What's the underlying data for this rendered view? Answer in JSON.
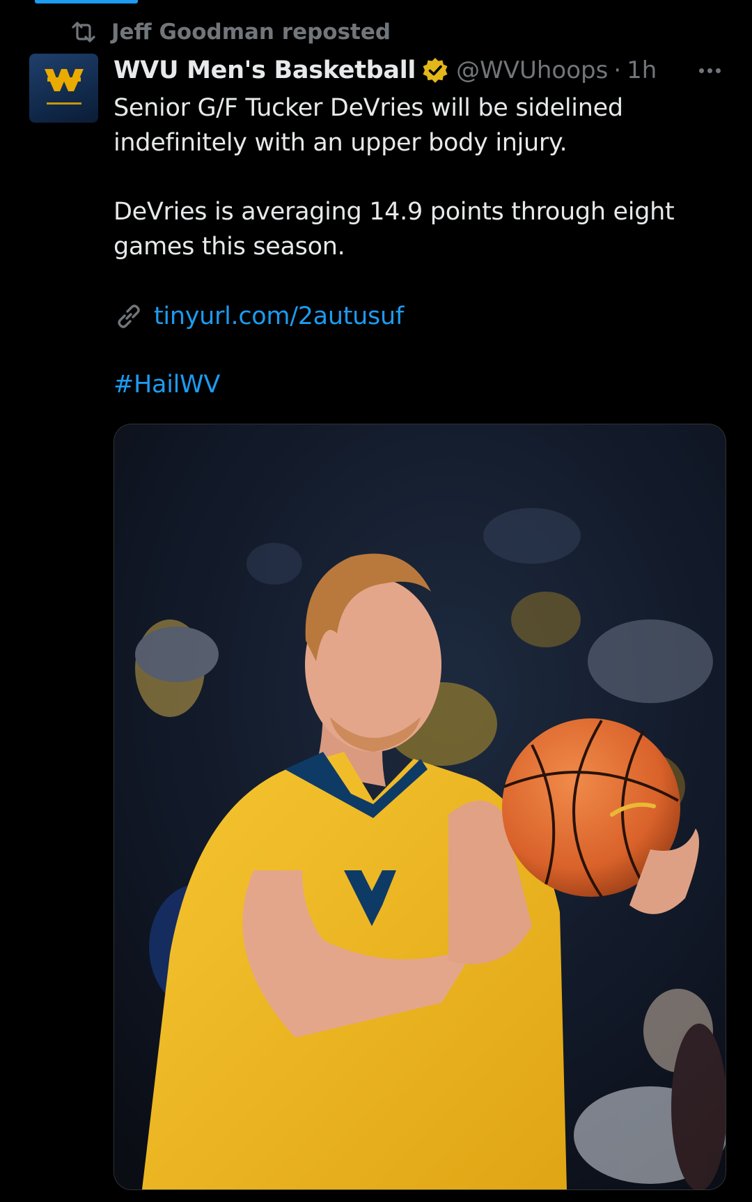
{
  "repost": {
    "icon": "repost-icon",
    "text": "Jeff Goodman reposted"
  },
  "author": {
    "avatar_icon": "wvu-logo-icon",
    "display_name": "WVU Men's Basketball",
    "verified_icon": "gold-verified-badge-icon",
    "handle": "@WVUhoops",
    "separator": "·",
    "time": "1h"
  },
  "more_icon": "more-dots-icon",
  "tweet": {
    "paragraphs": [
      "Senior G/F Tucker DeVries will be sidelined indefinitely with an upper body injury.",
      "DeVries is averaging 14.9 points through eight games this season."
    ],
    "link": {
      "icon": "link-icon",
      "text": "tinyurl.com/2autusuf"
    },
    "hashtag": "#HailWV"
  },
  "media": {
    "kind": "photo",
    "subject": "basketball player in gold jersey holding a basketball"
  },
  "colors": {
    "background": "#000000",
    "text": "#e7e9ea",
    "muted": "#71767b",
    "link": "#1d9bf0",
    "verified_gold": "#e2b719",
    "wvu_gold": "#eaaa00",
    "wvu_navy": "#002855"
  }
}
